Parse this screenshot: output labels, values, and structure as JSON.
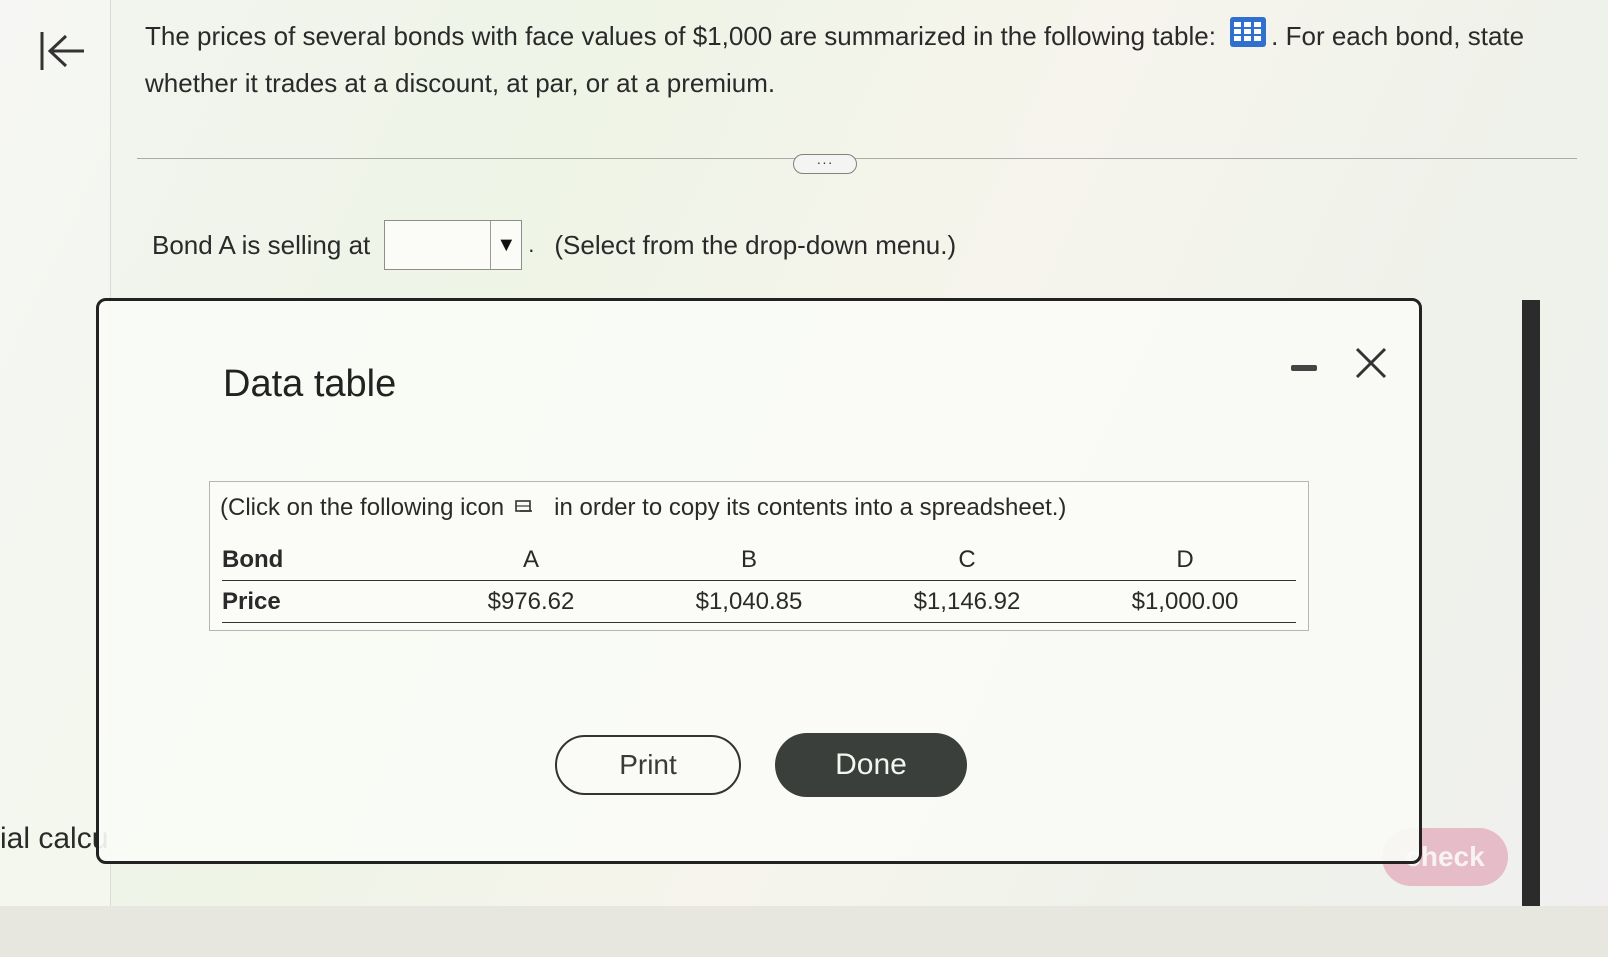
{
  "question": {
    "text_before_icon": "The prices of several bonds with face values of $1,000 are summarized in the following table:",
    "text_after_icon": ". For each bond, state whether it trades at a discount, at par, or at a premium."
  },
  "expand_button": "···",
  "answer": {
    "prefix": "Bond A is selling at",
    "selected_value": "",
    "dot": ".",
    "hint": "(Select from the drop-down menu.)"
  },
  "modal": {
    "title": "Data table",
    "instruction_before": "(Click on the following icon",
    "instruction_after": "in order to copy its contents into a spreadsheet.)",
    "table": {
      "row_labels": [
        "Bond",
        "Price"
      ],
      "bonds": [
        "A",
        "B",
        "C",
        "D"
      ],
      "prices": [
        "$976.62",
        "$1,040.85",
        "$1,146.92",
        "$1,000.00"
      ]
    },
    "print_label": "Print",
    "done_label": "Done"
  },
  "background": {
    "left_label": "ial calcu",
    "check_label": "check"
  },
  "colors": {
    "icon_blue": "#2f6fd0",
    "done_bg": "#3b3f3b",
    "check_bg": "#e6bcc8"
  }
}
